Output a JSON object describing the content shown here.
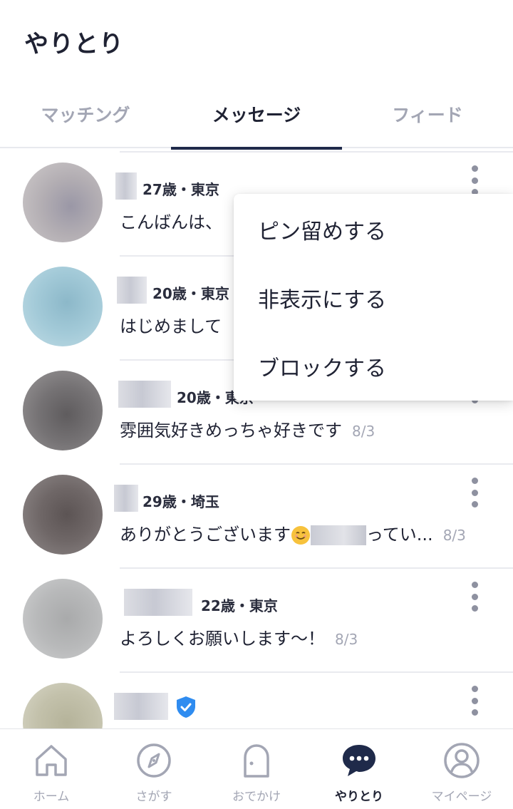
{
  "header": {
    "title": "やりとり"
  },
  "tabs": [
    {
      "label": "マッチング",
      "active": false
    },
    {
      "label": "メッセージ",
      "active": true
    },
    {
      "label": "フィード",
      "active": false
    }
  ],
  "conversations": [
    {
      "meta": "27歳・東京",
      "message": "こんばんは、",
      "date": ""
    },
    {
      "meta": "20歳・東京",
      "message": "はじめまして",
      "date": ""
    },
    {
      "meta": "20歳・東京",
      "message": "雰囲気好きめっちゃ好きです",
      "date": "8/3"
    },
    {
      "meta": "29歳・埼玉",
      "message_prefix": "ありがとうございます",
      "message_suffix": "ってい...",
      "date": "8/3"
    },
    {
      "meta": "22歳・東京",
      "message": "よろしくお願いします〜！",
      "date": "8/3"
    },
    {
      "meta": "",
      "message": "",
      "date": "",
      "verified": true
    }
  ],
  "context_menu": {
    "items": [
      "ピン留めする",
      "非表示にする",
      "ブロックする"
    ]
  },
  "bottom_nav": [
    {
      "label": "ホーム",
      "icon": "home-icon",
      "active": false
    },
    {
      "label": "さがす",
      "icon": "compass-icon",
      "active": false
    },
    {
      "label": "おでかけ",
      "icon": "outing-icon",
      "active": false
    },
    {
      "label": "やりとり",
      "icon": "chat-bubble-icon",
      "active": true
    },
    {
      "label": "マイページ",
      "icon": "profile-icon",
      "active": false
    }
  ],
  "colors": {
    "text_primary": "#1f2233",
    "text_secondary": "#a3a6b4",
    "accent_navy": "#1f2a4a",
    "verified_blue": "#2f8cf0"
  }
}
